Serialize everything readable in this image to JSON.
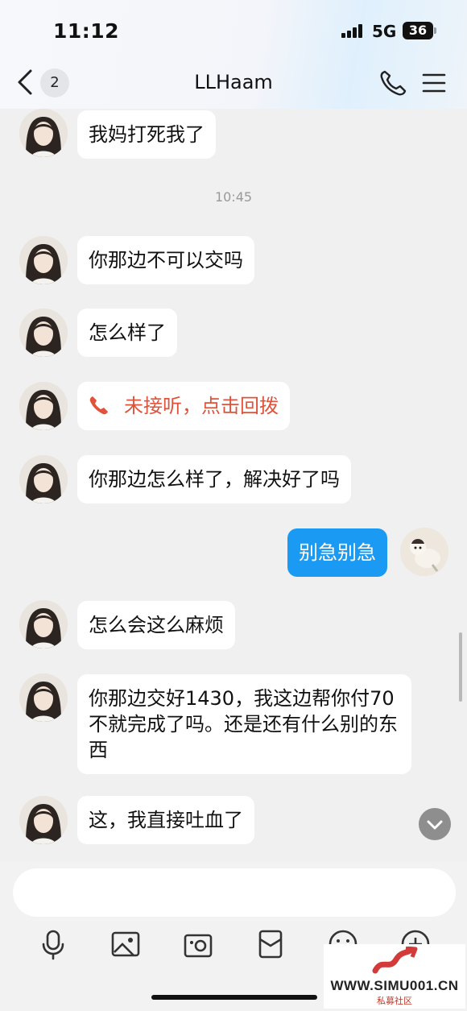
{
  "status_bar": {
    "time": "11:12",
    "network": "5G",
    "battery": "36"
  },
  "nav": {
    "unread_count": "2",
    "title": "LLHaam"
  },
  "messages": [
    {
      "side": "left",
      "text": "我妈打死我了"
    },
    {
      "type": "timestamp",
      "text": "10:45"
    },
    {
      "side": "left",
      "text": "你那边不可以交吗"
    },
    {
      "side": "left",
      "text": "怎么样了"
    },
    {
      "side": "left",
      "type": "missed-call",
      "text": "未接听，点击回拨"
    },
    {
      "side": "left",
      "text": "你那边怎么样了，解决好了吗"
    },
    {
      "side": "right",
      "text": "别急别急"
    },
    {
      "side": "left",
      "text": "怎么会这么麻烦"
    },
    {
      "side": "left",
      "text": "你那边交好1430，我这边帮你付70不就完成了吗。还是还有什么别的东西"
    },
    {
      "side": "left",
      "text": "这，我直接吐血了"
    }
  ],
  "input": {
    "placeholder": ""
  },
  "toolbar": [
    "mic-icon",
    "image-icon",
    "camera-icon",
    "red-packet-icon",
    "emoji-icon",
    "plus-icon"
  ],
  "watermark": {
    "text": "WWW.SIMU001.CN",
    "sub": "私募社区"
  },
  "colors": {
    "accent": "#1a9af3",
    "missed_call": "#e0533b",
    "background": "#f0f0f0"
  }
}
